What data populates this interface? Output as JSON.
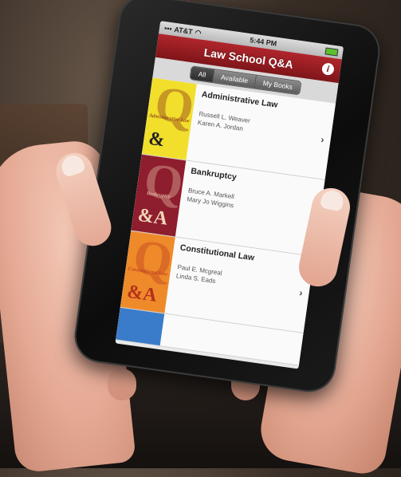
{
  "statusbar": {
    "carrier": "AT&T",
    "time": "5:44 PM"
  },
  "app": {
    "title": "Law School Q&A",
    "info_glyph": "i"
  },
  "segments": [
    {
      "label": "All",
      "active": true
    },
    {
      "label": "Available",
      "active": false
    },
    {
      "label": "My Books",
      "active": false
    }
  ],
  "books": [
    {
      "title": "Administrative Law",
      "authors": [
        "Russell L. Weaver",
        "Karen A. Jordan"
      ],
      "cover_title": "Administrative Law",
      "cover_q": "Q",
      "cover_amp": "&",
      "cover_color": "#f1df2c",
      "cover_text_color": "#7a1418"
    },
    {
      "title": "Bankruptcy",
      "authors": [
        "Bruce A. Markell",
        "Mary Jo Wiggins"
      ],
      "cover_title": "Bankruptcy",
      "cover_q": "Q",
      "cover_amp": "&A",
      "cover_color": "#8e1d2e",
      "cover_text_color": "#f1d6b8"
    },
    {
      "title": "Constitutional Law",
      "authors": [
        "Paul E. Mcgreal",
        "Linda S. Eads"
      ],
      "cover_title": "Constitutional Law",
      "cover_q": "Q",
      "cover_amp": "&A",
      "cover_color": "#ee8a2a",
      "cover_text_color": "#b5301e"
    }
  ],
  "chevron": "›",
  "colors": {
    "titlebar": "#9a1c22",
    "accent_red": "#d61c2a"
  }
}
